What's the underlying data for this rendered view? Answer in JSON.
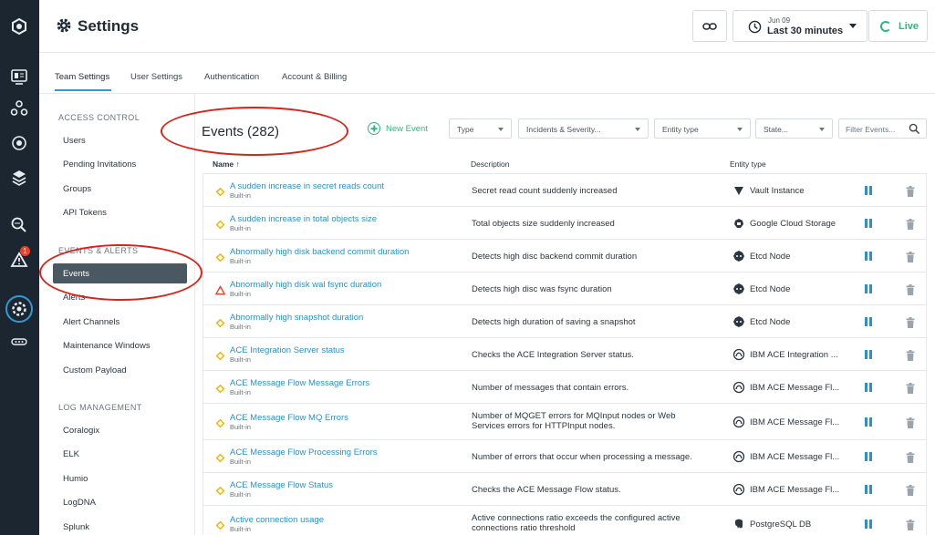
{
  "header": {
    "title": "Settings",
    "date": "Jun 09",
    "range": "Last 30 minutes",
    "live": "Live"
  },
  "tabs": [
    "Team Settings",
    "User Settings",
    "Authentication",
    "Account & Billing"
  ],
  "nav": {
    "access_control": "ACCESS CONTROL",
    "access_items": [
      "Users",
      "Pending Invitations",
      "Groups",
      "API Tokens"
    ],
    "events_alerts": "EVENTS & ALERTS",
    "events_items": [
      "Events",
      "Alerts",
      "Alert Channels",
      "Maintenance Windows",
      "Custom Payload"
    ],
    "log_management": "LOG MANAGEMENT",
    "log_items": [
      "Coralogix",
      "ELK",
      "Humio",
      "LogDNA",
      "Splunk"
    ]
  },
  "rail": {
    "alert_badge": "1"
  },
  "main": {
    "title": "Events (282)",
    "new_event": "New Event",
    "filters": {
      "type": "Type",
      "incidents": "Incidents & Severity...",
      "entity": "Entity type",
      "state": "State...",
      "search_placeholder": "Filter Events..."
    },
    "columns": {
      "name": "Name",
      "description": "Description",
      "entity": "Entity type"
    },
    "builtin_label": "Built-in",
    "rows": [
      {
        "name": "A sudden increase in secret reads count",
        "description": "Secret read count suddenly increased",
        "entity": "Vault Instance",
        "severity": "warning",
        "icon": "vault-icon"
      },
      {
        "name": "A sudden increase in total objects size",
        "description": "Total objects size suddenly increased",
        "entity": "Google Cloud Storage",
        "severity": "warning",
        "icon": "gcs-icon"
      },
      {
        "name": "Abnormally high disk backend commit duration",
        "description": "Detects high disc backend commit duration",
        "entity": "Etcd Node",
        "severity": "warning",
        "icon": "etcd-icon"
      },
      {
        "name": "Abnormally high disk wal fsync duration",
        "description": "Detects high disc was fsync duration",
        "entity": "Etcd Node",
        "severity": "critical",
        "icon": "etcd-icon"
      },
      {
        "name": "Abnormally high snapshot duration",
        "description": "Detects high duration of saving a snapshot",
        "entity": "Etcd Node",
        "severity": "warning",
        "icon": "etcd-icon"
      },
      {
        "name": "ACE Integration Server status",
        "description": "Checks the ACE Integration Server status.",
        "entity": "IBM ACE Integration ...",
        "severity": "warning",
        "icon": "ibm-ace-icon"
      },
      {
        "name": "ACE Message Flow Message Errors",
        "description": "Number of messages that contain errors.",
        "entity": "IBM ACE Message Fl...",
        "severity": "warning",
        "icon": "ibm-ace-icon"
      },
      {
        "name": "ACE Message Flow MQ Errors",
        "description": "Number of MQGET errors for MQInput nodes or Web Services errors for HTTPInput nodes.",
        "entity": "IBM ACE Message Fl...",
        "severity": "warning",
        "icon": "ibm-ace-icon"
      },
      {
        "name": "ACE Message Flow Processing Errors",
        "description": "Number of errors that occur when processing a message.",
        "entity": "IBM ACE Message Fl...",
        "severity": "warning",
        "icon": "ibm-ace-icon"
      },
      {
        "name": "ACE Message Flow Status",
        "description": "Checks the ACE Message Flow status.",
        "entity": "IBM ACE Message Fl...",
        "severity": "warning",
        "icon": "ibm-ace-icon"
      },
      {
        "name": "Active connection usage",
        "description": "Active connections ratio exceeds the configured active connections ratio threshold",
        "entity": "PostgreSQL DB",
        "severity": "warning",
        "icon": "postgres-icon"
      }
    ]
  },
  "colors": {
    "accent": "#2e9bd6",
    "link": "#2e8fc9",
    "green": "#2eb67d",
    "warning": "#f2b600",
    "critical": "#e4442b",
    "annotation": "#d9231b"
  }
}
